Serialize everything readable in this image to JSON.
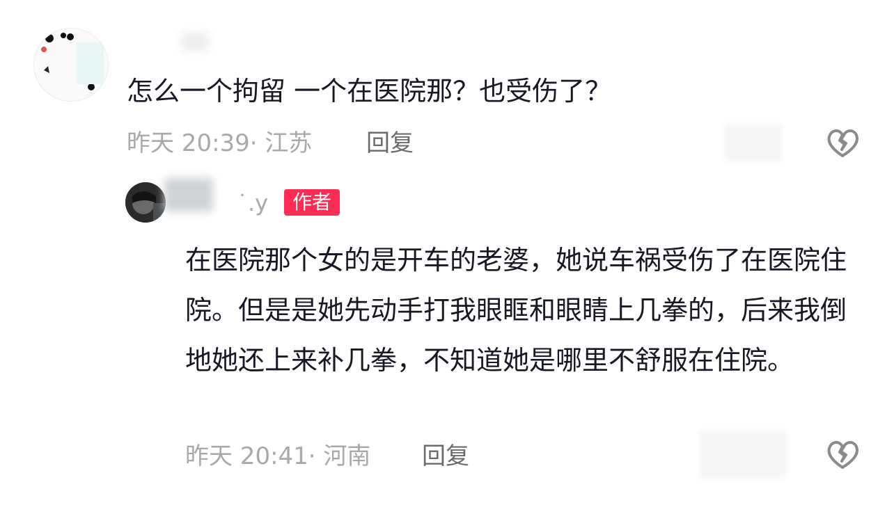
{
  "comment": {
    "username": "",
    "text": "怎么一个拘留 一个在医院那？也受伤了？",
    "time_location": "昨天 20:39· 江苏",
    "reply_label": "回复"
  },
  "reply": {
    "username": "˙.y",
    "badge": "作者",
    "text": "在医院那个女的是开车的老婆，她说车祸受伤了在医院住院。但是是她先动手打我眼眶和眼睛上几拳的，后来我倒地她还上来补几拳，不知道她是哪里不舒服在住院。",
    "time_location": "昨天 20:41· 河南",
    "reply_label": "回复"
  },
  "icons": {
    "dislike": "broken-heart-icon"
  },
  "colors": {
    "badge": "#fe2c55",
    "meta": "#a9a9ab"
  }
}
